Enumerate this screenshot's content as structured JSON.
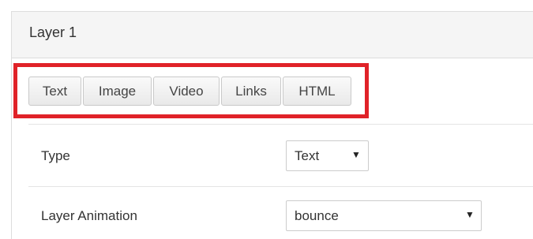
{
  "panel": {
    "title": "Layer 1"
  },
  "tabs": [
    {
      "label": "Text"
    },
    {
      "label": "Image"
    },
    {
      "label": "Video"
    },
    {
      "label": "Links"
    },
    {
      "label": "HTML"
    }
  ],
  "form": {
    "type": {
      "label": "Type",
      "value": "Text"
    },
    "animation": {
      "label": "Layer Animation",
      "value": "bounce"
    }
  },
  "icons": {
    "dropdown": "▼"
  },
  "colors": {
    "highlight": "#e02228",
    "header_bg": "#f5f5f5"
  }
}
